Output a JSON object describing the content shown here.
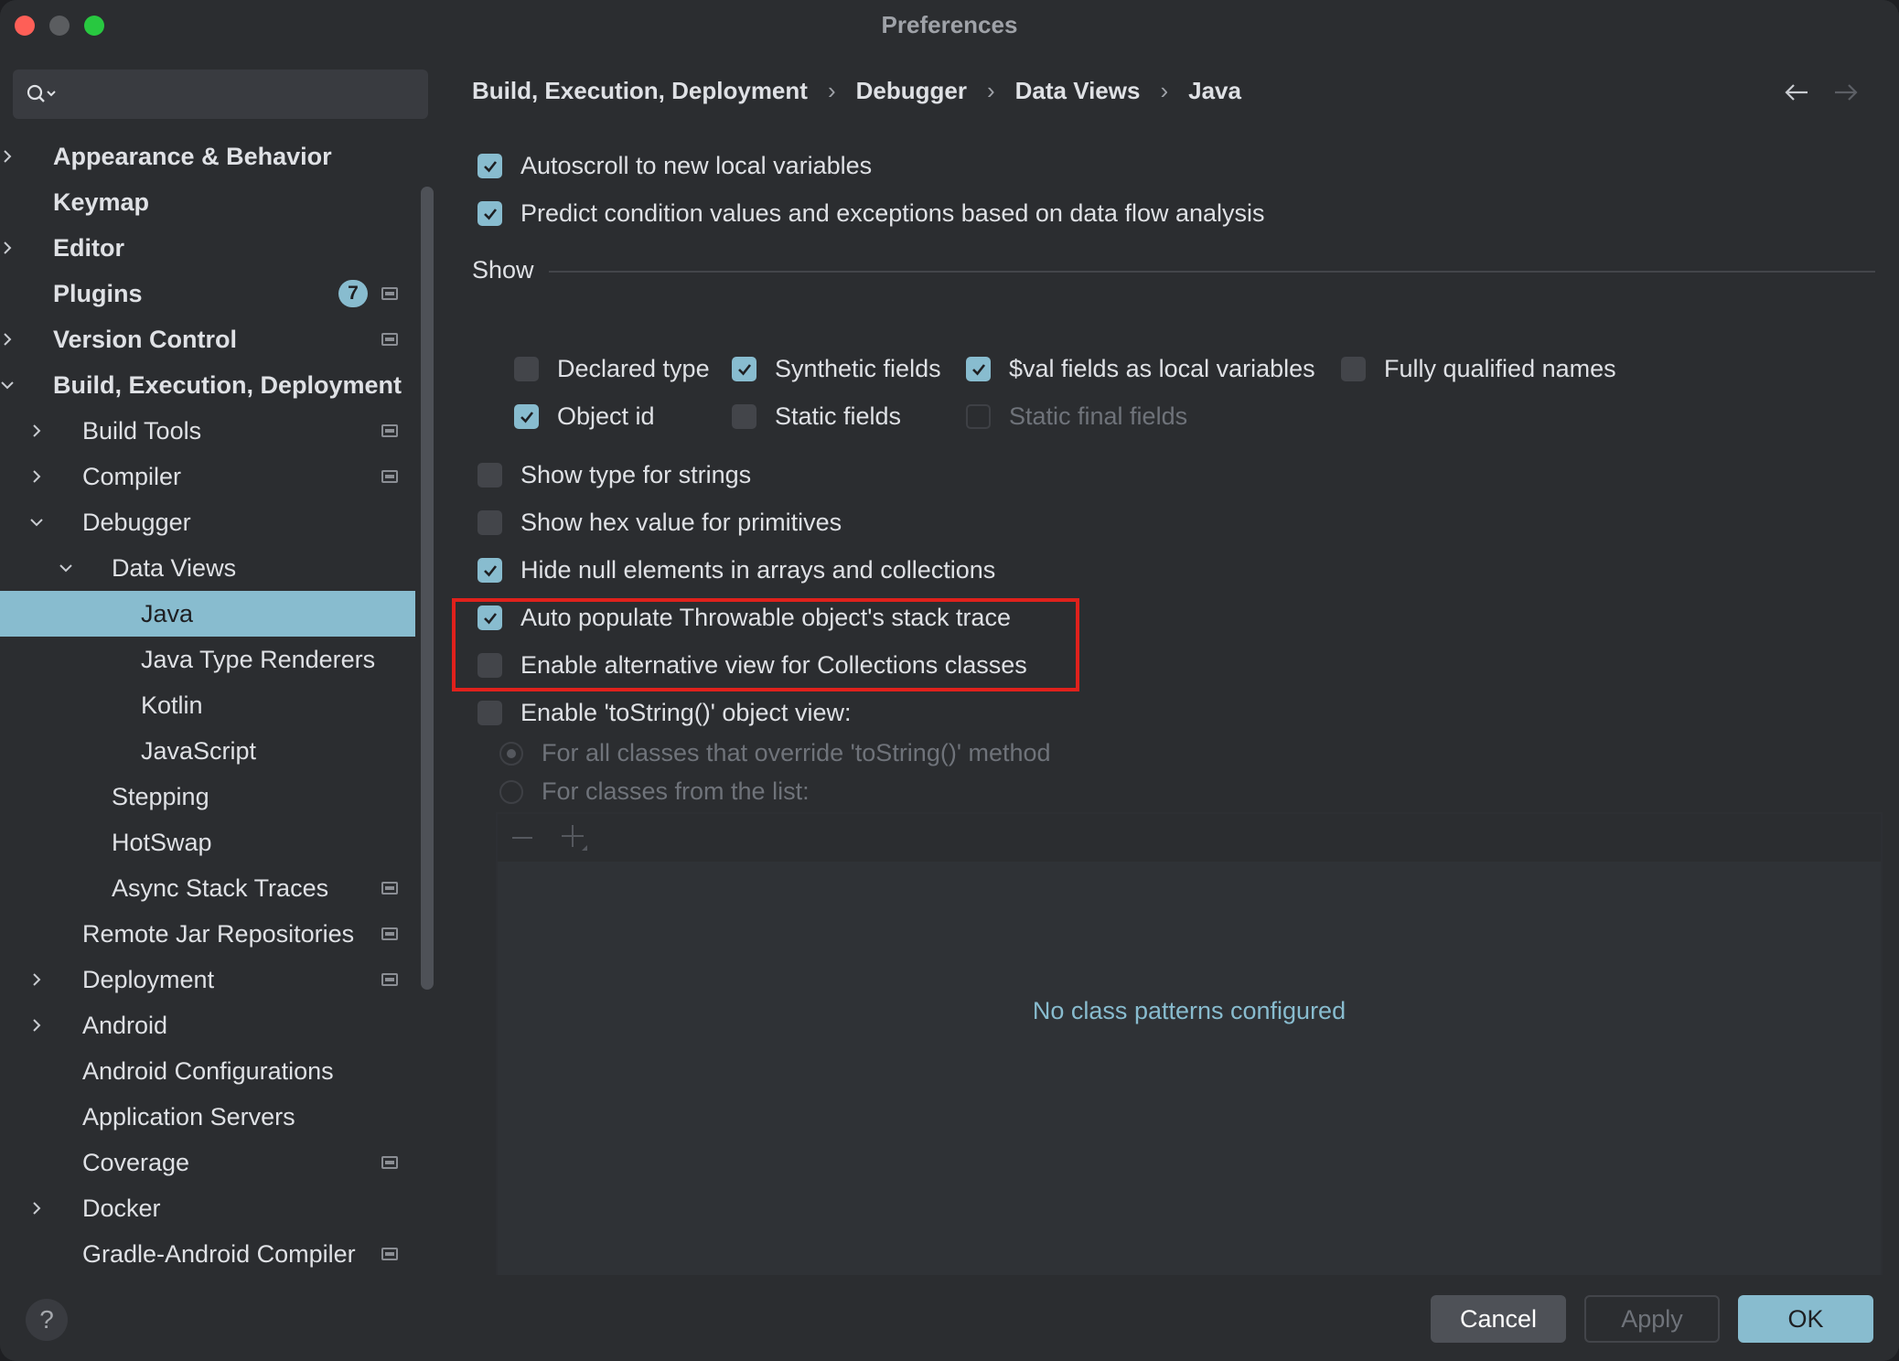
{
  "window": {
    "title": "Preferences"
  },
  "search": {
    "placeholder": ""
  },
  "sidebar": {
    "items": [
      {
        "label": "Appearance & Behavior",
        "level": 0,
        "bold": true,
        "chevron": "right",
        "gear": false
      },
      {
        "label": "Keymap",
        "level": 0,
        "bold": true,
        "chevron": "",
        "gear": false
      },
      {
        "label": "Editor",
        "level": 0,
        "bold": true,
        "chevron": "right",
        "gear": false
      },
      {
        "label": "Plugins",
        "level": 0,
        "bold": true,
        "chevron": "",
        "gear": true,
        "badge": "7"
      },
      {
        "label": "Version Control",
        "level": 0,
        "bold": true,
        "chevron": "right",
        "gear": true
      },
      {
        "label": "Build, Execution, Deployment",
        "level": 0,
        "bold": true,
        "chevron": "down",
        "gear": false
      },
      {
        "label": "Build Tools",
        "level": 1,
        "bold": false,
        "chevron": "right",
        "gear": true
      },
      {
        "label": "Compiler",
        "level": 1,
        "bold": false,
        "chevron": "right",
        "gear": true
      },
      {
        "label": "Debugger",
        "level": 1,
        "bold": false,
        "chevron": "down",
        "gear": false
      },
      {
        "label": "Data Views",
        "level": 2,
        "bold": false,
        "chevron": "down",
        "gear": false
      },
      {
        "label": "Java",
        "level": 3,
        "bold": false,
        "chevron": "",
        "gear": false,
        "selected": true
      },
      {
        "label": "Java Type Renderers",
        "level": 3,
        "bold": false,
        "chevron": "",
        "gear": false
      },
      {
        "label": "Kotlin",
        "level": 3,
        "bold": false,
        "chevron": "",
        "gear": false
      },
      {
        "label": "JavaScript",
        "level": 3,
        "bold": false,
        "chevron": "",
        "gear": false
      },
      {
        "label": "Stepping",
        "level": 2,
        "bold": false,
        "chevron": "",
        "gear": false
      },
      {
        "label": "HotSwap",
        "level": 2,
        "bold": false,
        "chevron": "",
        "gear": false
      },
      {
        "label": "Async Stack Traces",
        "level": 2,
        "bold": false,
        "chevron": "",
        "gear": true
      },
      {
        "label": "Remote Jar Repositories",
        "level": 1,
        "bold": false,
        "chevron": "",
        "gear": true
      },
      {
        "label": "Deployment",
        "level": 1,
        "bold": false,
        "chevron": "right",
        "gear": true
      },
      {
        "label": "Android",
        "level": 1,
        "bold": false,
        "chevron": "right",
        "gear": false
      },
      {
        "label": "Android Configurations",
        "level": 1,
        "bold": false,
        "chevron": "",
        "gear": false
      },
      {
        "label": "Application Servers",
        "level": 1,
        "bold": false,
        "chevron": "",
        "gear": false
      },
      {
        "label": "Coverage",
        "level": 1,
        "bold": false,
        "chevron": "",
        "gear": true
      },
      {
        "label": "Docker",
        "level": 1,
        "bold": false,
        "chevron": "right",
        "gear": false
      },
      {
        "label": "Gradle-Android Compiler",
        "level": 1,
        "bold": false,
        "chevron": "",
        "gear": true
      }
    ]
  },
  "breadcrumb": [
    "Build, Execution, Deployment",
    "Debugger",
    "Data Views",
    "Java"
  ],
  "options": {
    "autoscroll": {
      "label": "Autoscroll to new local variables",
      "checked": true
    },
    "predict": {
      "label": "Predict condition values and exceptions based on data flow analysis",
      "checked": true
    },
    "show_section": "Show",
    "declared_type": {
      "label": "Declared type",
      "checked": false
    },
    "synthetic_fields": {
      "label": "Synthetic fields",
      "checked": true
    },
    "val_fields": {
      "label": "$val fields as local variables",
      "checked": true
    },
    "fully_qualified": {
      "label": "Fully qualified names",
      "checked": false
    },
    "object_id": {
      "label": "Object id",
      "checked": true
    },
    "static_fields": {
      "label": "Static fields",
      "checked": false
    },
    "static_final_fields": {
      "label": "Static final fields",
      "checked": false,
      "disabled": true
    },
    "type_for_strings": {
      "label": "Show type for strings",
      "checked": false
    },
    "hex_value": {
      "label": "Show hex value for primitives",
      "checked": false
    },
    "hide_null": {
      "label": "Hide null elements in arrays and collections",
      "checked": true
    },
    "auto_populate": {
      "label": "Auto populate Throwable object's stack trace",
      "checked": true
    },
    "alt_view": {
      "label": "Enable alternative view for Collections classes",
      "checked": false
    },
    "tostring_view": {
      "label": "Enable 'toString()' object view:",
      "checked": false
    },
    "radio_all": {
      "label": "For all classes that override 'toString()' method",
      "selected": true,
      "disabled": true
    },
    "radio_list": {
      "label": "For classes from the list:",
      "selected": false,
      "disabled": true
    }
  },
  "class_list": {
    "empty_text": "No class patterns configured"
  },
  "footer": {
    "help": "?",
    "cancel": "Cancel",
    "apply": "Apply",
    "ok": "OK"
  },
  "colors": {
    "accent": "#88bccf",
    "background": "#2b2d30",
    "highlight_box": "#e0211c"
  }
}
